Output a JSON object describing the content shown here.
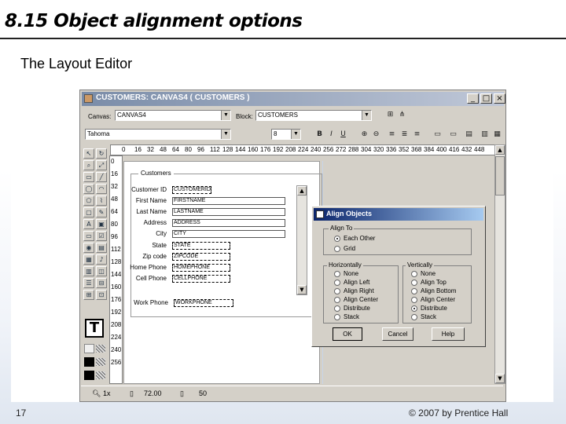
{
  "slide": {
    "title": "8.15 Object alignment options",
    "subtitle": "The Layout Editor",
    "page_number": "17",
    "copyright": "© 2007 by Prentice Hall"
  },
  "window": {
    "title": "CUSTOMERS: CANVAS4 ( CUSTOMERS )",
    "controls": {
      "minimize": "_",
      "maximize": "□",
      "close": "×"
    },
    "toolbar": {
      "canvas_label": "Canvas:",
      "canvas_value": "CANVAS4",
      "block_label": "Block:",
      "block_value": "CUSTOMERS",
      "font_value": "Tahoma",
      "font_size_value": "8",
      "bold": "B",
      "italic": "I",
      "underline": "U"
    },
    "ruler_h": [
      "0",
      "16",
      "32",
      "48",
      "64",
      "80",
      "96",
      "112",
      "128",
      "144",
      "160",
      "176",
      "192",
      "208",
      "224",
      "240",
      "256",
      "272",
      "288",
      "304",
      "320",
      "336",
      "352",
      "368",
      "384",
      "400",
      "416",
      "432",
      "448"
    ],
    "ruler_v": [
      "0",
      "16",
      "32",
      "48",
      "64",
      "80",
      "96",
      "112",
      "128",
      "144",
      "160",
      "176",
      "192",
      "208",
      "224",
      "240",
      "256"
    ],
    "frame_title": "Customers",
    "form_items": [
      {
        "label": "Customer ID",
        "value": "CUSTOMERID"
      },
      {
        "label": "First Name",
        "value": "FIRSTNAME"
      },
      {
        "label": "Last Name",
        "value": "LASTNAME"
      },
      {
        "label": "Address",
        "value": "ADDRESS"
      },
      {
        "label": "City",
        "value": "CITY"
      },
      {
        "label": "State",
        "value": "STATE"
      },
      {
        "label": "Zip code",
        "value": "ZIPCODE"
      },
      {
        "label": "Home Phone",
        "value": "HOMEPHONE"
      },
      {
        "label": "Cell Phone",
        "value": "CELLPHONE"
      },
      {
        "label": "Work Phone",
        "value": "WORKPHONE"
      }
    ],
    "status": {
      "zoom": "1x",
      "x": "72.00",
      "y": "50"
    },
    "palette_big_tool": "T"
  },
  "dialog": {
    "title": "Align Objects",
    "align_to_label": "Align To",
    "align_to_options": [
      {
        "label": "Each Other",
        "selected": true
      },
      {
        "label": "Grid",
        "selected": false
      }
    ],
    "horizontally_label": "Horizontally",
    "horizontally_options": [
      {
        "label": "None",
        "selected": false
      },
      {
        "label": "Align Left",
        "selected": false
      },
      {
        "label": "Align Right",
        "selected": false
      },
      {
        "label": "Align Center",
        "selected": false
      },
      {
        "label": "Distribute",
        "selected": false
      },
      {
        "label": "Stack",
        "selected": false
      }
    ],
    "vertically_label": "Vertically",
    "vertically_options": [
      {
        "label": "None",
        "selected": false
      },
      {
        "label": "Align Top",
        "selected": false
      },
      {
        "label": "Align Bottom",
        "selected": false
      },
      {
        "label": "Align Center",
        "selected": false
      },
      {
        "label": "Distribute",
        "selected": true
      },
      {
        "label": "Stack",
        "selected": false
      }
    ],
    "ok_label": "OK",
    "cancel_label": "Cancel",
    "help_label": "Help"
  },
  "colors": {
    "title_bar": "#0a246a",
    "window_face": "#d4d0c8"
  }
}
